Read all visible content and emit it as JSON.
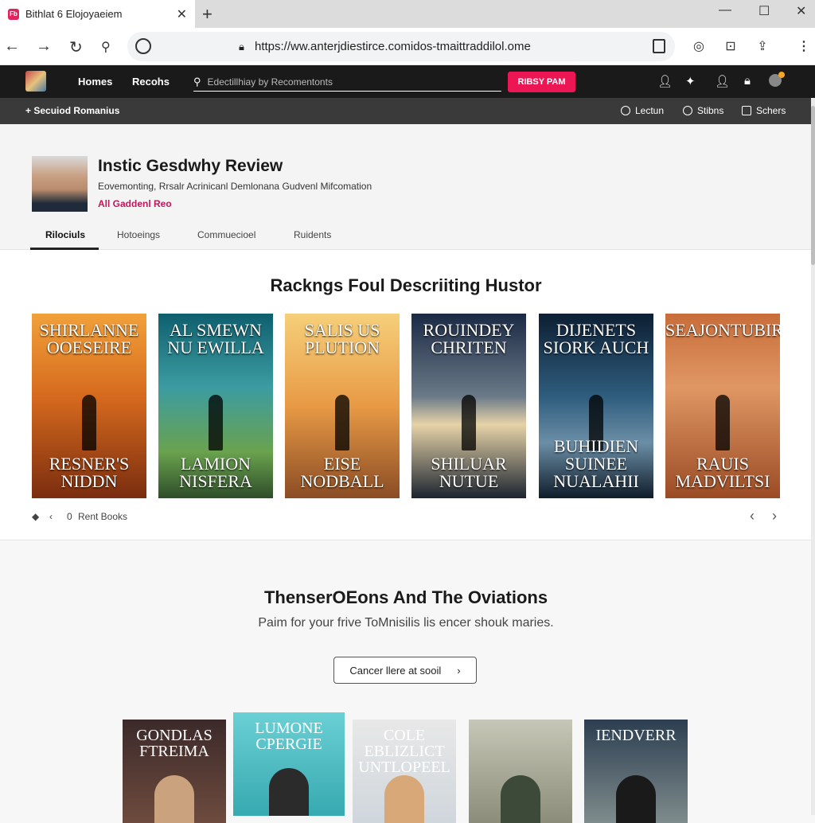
{
  "browser": {
    "tab_title": "Bithlat 6 Elojoyaeiem",
    "favicon_text": "Fb",
    "url": "https://ww.anterjdiestirce.comidos-tmaittraddilol.ome",
    "toolbar_icons": [
      "back-icon",
      "forward-icon",
      "reload-icon",
      "lens-icon",
      "info-icon",
      "reader-icon",
      "cast-icon",
      "share-icon",
      "menu-icon"
    ]
  },
  "site": {
    "nav": [
      "Homes",
      "Recohs"
    ],
    "search_placeholder": "Edectillhiay by Recomentonts",
    "cta_label": "RIBSY PAM",
    "subbar": {
      "crumb": "Secuiod Romanius",
      "links": [
        "Lectun",
        "Stibns",
        "Schers"
      ]
    }
  },
  "profile": {
    "title": "Instic Gesdwhy Review",
    "subtitle": "Eovemonting, Rrsalr Acrinicanl Demlonana Gudvenl Mifcomation",
    "link": "All Gaddenl Reo",
    "tabs": [
      "Rilociuls",
      "Hotoeings",
      "Commuecioel",
      "Ruidents"
    ]
  },
  "carousel": {
    "heading": "Rackngs Foul Descriiting Hustor",
    "books": [
      {
        "top": "SHIRLANNE OOESEIRE",
        "bottom": "RESNER'S NIDDN",
        "bg": "linear-gradient(180deg,#f1a13a 0%,#d66a1e 45%,#7a2d0f 100%)"
      },
      {
        "top": "AL SMEWN NU EWILLA",
        "bottom": "LAMION NISFERA",
        "bg": "linear-gradient(180deg,#0f5f6e 0%,#3c9ca1 40%,#6aa24e 75%,#2e4d2a 100%)"
      },
      {
        "top": "SALIS US PLUTION",
        "bottom": "EISE NODBALL",
        "bg": "linear-gradient(180deg,#f6cf7a 0%,#e89a45 50%,#8a4c24 100%)"
      },
      {
        "top": "ROUINDEY CHRITEN",
        "bottom": "SHILUAR NUTUE",
        "bg": "linear-gradient(180deg,#1b2a44 0%,#6b7a88 45%,#e6d3a8 60%,#1c2430 100%)"
      },
      {
        "top": "DIJENETS SIORK AUCH",
        "bottom": "BUHIDIEN SUINEE NUALAHII",
        "bg": "linear-gradient(180deg,#0d1f33 0%,#2f5d7e 45%,#6b8ea6 70%,#0f1c2a 100%)"
      },
      {
        "top": "SEAJONTUBIRE",
        "bottom": "RAUIS MADVILTSI",
        "bg": "linear-gradient(180deg,#c86d3a 0%,#e09764 40%,#9a4b24 100%)"
      }
    ],
    "controls": {
      "label": "Rent Books"
    }
  },
  "section2": {
    "heading": "ThenserOEons And The Oviations",
    "lead": "Paim for your frive ToMnisilis lis encer shouk maries.",
    "button": "Cancer llere at sooil",
    "books": [
      {
        "title": "GONDLAS FTREIMA",
        "bg": "linear-gradient(180deg,#3b2a2a 0%,#6e4b3e 100%)",
        "fig": "#caa27e"
      },
      {
        "title": "LUMONE CPERGIE",
        "bg": "linear-gradient(180deg,#6ad0d5 0%,#37a9b0 100%)",
        "fig": "#2b2b2b"
      },
      {
        "title": "COLE EBLIZLICT UNTLOPEEL",
        "bg": "linear-gradient(180deg,#e8e8e8 0%,#cfd6dc 100%)",
        "fig": "#d8a878"
      },
      {
        "title": "",
        "bg": "linear-gradient(180deg,#c7c7b7 0%,#8c8c7a 100%)",
        "fig": "#3d4a3a"
      },
      {
        "title": "IENDVERR",
        "bg": "linear-gradient(180deg,#2c3e50 0%,#7f8c8d 100%)",
        "fig": "#1a1a1a"
      }
    ]
  }
}
